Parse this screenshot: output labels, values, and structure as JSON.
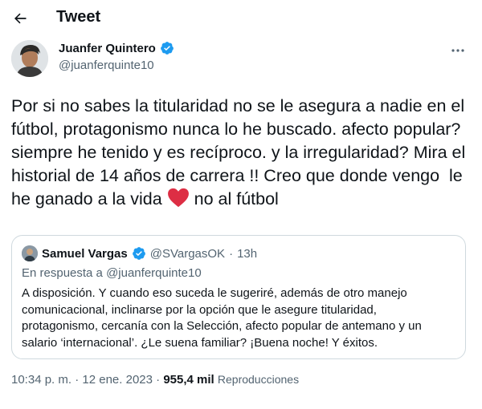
{
  "header": {
    "title": "Tweet",
    "back_icon": "arrow-left-icon"
  },
  "author": {
    "name": "Juanfer Quintero",
    "handle": "@juanferquinte10",
    "verified_icon": "verified-badge-icon",
    "more_icon": "more-horizontal-icon"
  },
  "tweet": {
    "text_part1": "Por si no sabes la titularidad no se le asegura a nadie en el fútbol, protagonismo nunca lo he buscado. afecto popular?  siempre he tenido y es recíproco. y la irregularidad? Mira el historial de 14 años de carrera !! Creo que donde vengo  le he ganado a la vida ",
    "heart_icon": "red-heart-emoji-icon",
    "text_part2": " no al fútbol"
  },
  "quote": {
    "name": "Samuel Vargas",
    "handle": "@SVargasOK",
    "separator": "·",
    "time": "13h",
    "reply_to": "En respuesta a @juanferquinte10",
    "text": "A disposición. Y cuando eso suceda le sugeriré, además de otro manejo comunicacional, inclinarse por la opción que le asegure titularidad, protagonismo, cercanía con la Selección, afecto popular de antemano y un salario ‘internacional’. ¿Le suena familiar? ¡Buena noche! Y éxitos."
  },
  "meta": {
    "time": "10:34 p. m.",
    "sep1": " · ",
    "date": "12 ene. 2023",
    "sep2": " · ",
    "views": "955,4 mil",
    "views_label": "Reproducciones"
  },
  "colors": {
    "accent": "#1d9bf0",
    "text": "#0f1419",
    "muted": "#536471",
    "border": "#cfd9de",
    "heart": "#e0245e"
  }
}
